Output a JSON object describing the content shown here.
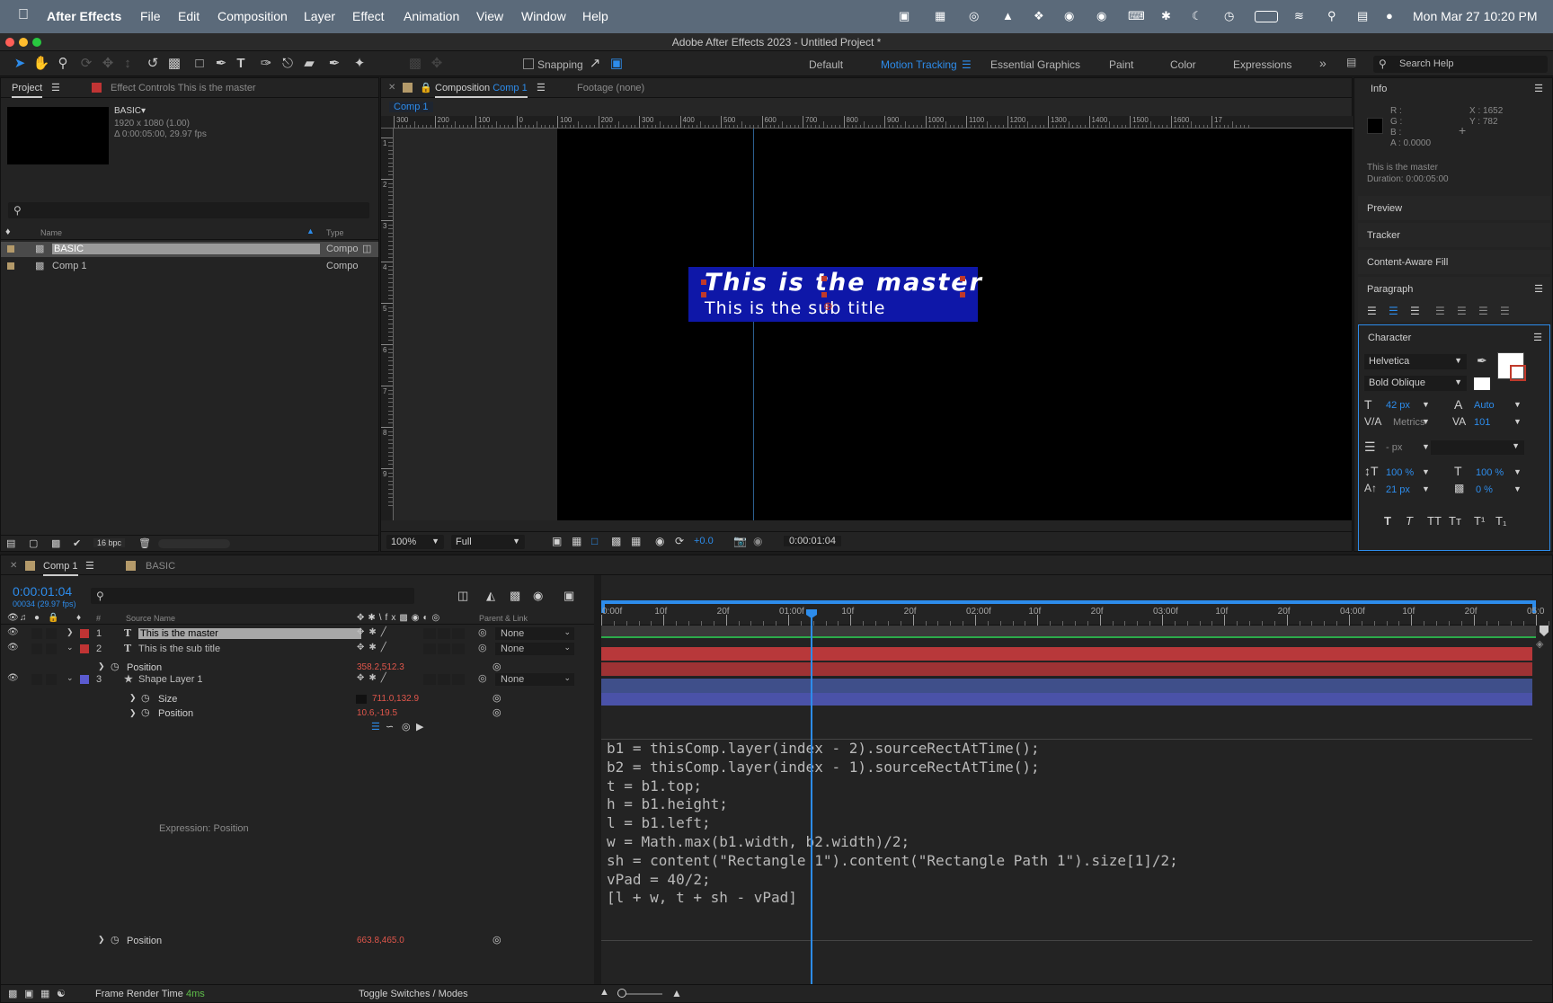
{
  "menubar": {
    "app_name": "After Effects",
    "items": [
      "File",
      "Edit",
      "Composition",
      "Layer",
      "Effect",
      "Animation",
      "View",
      "Window",
      "Help"
    ],
    "datetime": "Mon Mar 27  10:20 PM"
  },
  "window": {
    "title": "Adobe After Effects 2023 - Untitled Project *"
  },
  "toolbar": {
    "snapping_label": "Snapping",
    "workspaces": [
      "Default",
      "Motion Tracking",
      "Essential Graphics",
      "Paint",
      "Color",
      "Expressions"
    ],
    "active_workspace": "Motion Tracking",
    "search_placeholder": "Search Help"
  },
  "project_panel": {
    "tab_project": "Project",
    "tab_effect_controls": "Effect Controls This is the master",
    "selected_name": "BASIC▾",
    "selected_dims": "1920 x 1080 (1.00)",
    "selected_duration": "Δ 0:00:05:00, 29.97 fps",
    "col_name": "Name",
    "col_type": "Type",
    "items": [
      {
        "name": "BASIC",
        "type": "Compo",
        "selected": true
      },
      {
        "name": "Comp 1",
        "type": "Compo",
        "selected": false
      }
    ],
    "bpc": "16 bpc"
  },
  "comp_panel": {
    "tab_prefix": "Composition",
    "tab_comp": "Comp 1",
    "footage_tab": "Footage (none)",
    "breadcrumb": "Comp 1",
    "ruler_labels": [
      "300",
      "200",
      "100",
      "0",
      "100",
      "200",
      "300",
      "400",
      "500",
      "600",
      "700",
      "800",
      "900",
      "1000",
      "1100",
      "1200",
      "1300",
      "1400",
      "1500",
      "1600",
      "17"
    ],
    "v_ruler_labels": [
      "1",
      "2",
      "3",
      "4",
      "5",
      "6",
      "7",
      "8",
      "9"
    ],
    "master_text": "This is the master",
    "sub_text": "This is the sub title",
    "zoom": "100%",
    "quality": "Full",
    "exposure": "+0.0",
    "timecode": "0:00:01:04"
  },
  "info_panel": {
    "title": "Info",
    "r": "R :",
    "g": "G :",
    "b": "B :",
    "a": "A :  0.0000",
    "x": "X : 1652",
    "y": "Y : 782",
    "layer_name": "This is the master",
    "duration": "Duration: 0:00:05:00",
    "preview": "Preview",
    "tracker": "Tracker",
    "content_aware_fill": "Content-Aware Fill",
    "paragraph": "Paragraph"
  },
  "character_panel": {
    "title": "Character",
    "font": "Helvetica",
    "style": "Bold Oblique",
    "font_size": "42 px",
    "leading": "Auto",
    "kerning": "Metrics",
    "tracking": "101",
    "stroke": "- px",
    "vscale": "100 %",
    "hscale": "100 %",
    "baseline": "21 px",
    "tsume": "0 %"
  },
  "timeline": {
    "tab_comp": "Comp 1",
    "tab_basic": "BASIC",
    "timecode": "0:00:01:04",
    "frames": "00034 (29.97 fps)",
    "col_source_name": "Source Name",
    "col_parent": "Parent & Link",
    "ruler_labels": [
      "0:00f",
      "10f",
      "20f",
      "01:00f",
      "10f",
      "20f",
      "02:00f",
      "10f",
      "20f",
      "03:00f",
      "10f",
      "20f",
      "04:00f",
      "10f",
      "20f",
      "05:0"
    ],
    "layers": [
      {
        "num": "1",
        "name": "This is the master",
        "parent": "None",
        "color": "#c03434"
      },
      {
        "num": "2",
        "name": "This is the sub title",
        "parent": "None",
        "color": "#c03434"
      },
      {
        "num": "3",
        "name": "Shape Layer 1",
        "parent": "None",
        "color": "#5b5bd0"
      }
    ],
    "props": {
      "position1_label": "Position",
      "position1_value": "358.2,512.3",
      "size_label": "Size",
      "size_value": "711.0,132.9",
      "position2_label": "Position",
      "position2_value": "10.6,-19.5",
      "expression_label": "Expression: Position",
      "position3_label": "Position",
      "position3_value": "663.8,465.0"
    },
    "expression_lines": [
      "b1 = thisComp.layer(index - 2).sourceRectAtTime();",
      "b2 = thisComp.layer(index - 1).sourceRectAtTime();",
      "t = b1.top;",
      "h = b1.height;",
      "l = b1.left;",
      "w = Math.max(b1.width, b2.width)/2;",
      "sh = content(\"Rectangle 1\").content(\"Rectangle Path 1\").size[1]/2;",
      "vPad = 40/2;",
      "[l + w, t + sh - vPad]"
    ],
    "frame_render_label": "Frame Render Time",
    "frame_render_value": "4ms",
    "toggle_label": "Toggle Switches / Modes"
  }
}
